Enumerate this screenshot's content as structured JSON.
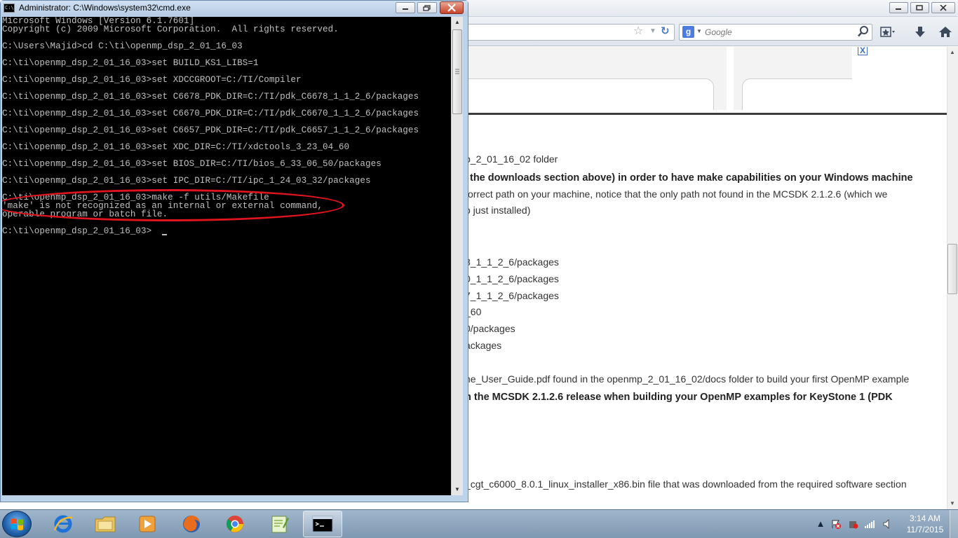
{
  "cmd": {
    "title": "Administrator: C:\\Windows\\system32\\cmd.exe",
    "icon_text": "C:\\",
    "lines": [
      "Microsoft Windows [Version 6.1.7601]",
      "Copyright (c) 2009 Microsoft Corporation.  All rights reserved.",
      "",
      "C:\\Users\\Majid>cd C:\\ti\\openmp_dsp_2_01_16_03",
      "",
      "C:\\ti\\openmp_dsp_2_01_16_03>set BUILD_KS1_LIBS=1",
      "",
      "C:\\ti\\openmp_dsp_2_01_16_03>set XDCCGROOT=C:/TI/Compiler",
      "",
      "C:\\ti\\openmp_dsp_2_01_16_03>set C6678_PDK_DIR=C:/TI/pdk_C6678_1_1_2_6/packages",
      "",
      "C:\\ti\\openmp_dsp_2_01_16_03>set C6670_PDK_DIR=C:/TI/pdk_C6670_1_1_2_6/packages",
      "",
      "C:\\ti\\openmp_dsp_2_01_16_03>set C6657_PDK_DIR=C:/TI/pdk_C6657_1_1_2_6/packages",
      "",
      "C:\\ti\\openmp_dsp_2_01_16_03>set XDC_DIR=C:/TI/xdctools_3_23_04_60",
      "",
      "C:\\ti\\openmp_dsp_2_01_16_03>set BIOS_DIR=C:/TI/bios_6_33_06_50/packages",
      "",
      "C:\\ti\\openmp_dsp_2_01_16_03>set IPC_DIR=C:/TI/ipc_1_24_03_32/packages",
      "",
      "C:\\ti\\openmp_dsp_2_01_16_03>make -f utils/Makefile",
      "'make' is not recognized as an internal or external command,",
      "operable program or batch file.",
      "",
      "C:\\ti\\openmp_dsp_2_01_16_03>"
    ]
  },
  "browser": {
    "search_placeholder": "Google",
    "search_engine_letter": "g",
    "ad_close_label": "X",
    "content_lines": [
      {
        "text": "p_2_01_16_02 folder",
        "bold": false
      },
      {
        "text": "the downloads section above) in order to have make capabilities on your Windows machine",
        "bold": true
      },
      {
        "text": "orrect path on your machine, notice that the only path not found in the MCSDK 2.1.2.6 (which we",
        "bold": false
      },
      {
        "text": "o just installed)",
        "bold": false
      },
      {
        "text": "8_1_1_2_6/packages",
        "bold": false
      },
      {
        "text": "0_1_1_2_6/packages",
        "bold": false
      },
      {
        "text": "7_1_1_2_6/packages",
        "bold": false
      },
      {
        "text": "_60",
        "bold": false
      },
      {
        "text": "0/packages",
        "bold": false
      },
      {
        "text": "ackages",
        "bold": false
      },
      {
        "text": "ne_User_Guide.pdf found in the openmp_2_01_16_02/docs folder to build your first OpenMP example",
        "bold": false
      },
      {
        "text": "n the MCSDK 2.1.2.6 release when building your OpenMP examples for KeyStone 1 (PDK",
        "bold": true
      },
      {
        "text": "_cgt_c6000_8.0.1_linux_installer_x86.bin file that was downloaded from the required software section",
        "bold": false
      }
    ]
  },
  "taskbar": {
    "apps": [
      "internet-explorer",
      "windows-explorer",
      "media-player",
      "firefox",
      "chrome",
      "notepad-plus-plus",
      "command-prompt"
    ],
    "active_app": "command-prompt",
    "clock_time": "3:14 AM",
    "clock_date": "11/7/2015"
  },
  "colors": {
    "console_bg": "#000000",
    "console_fg": "#c0c0c0",
    "highlight": "#e0141c",
    "titlebar": "#bcd3ea"
  }
}
